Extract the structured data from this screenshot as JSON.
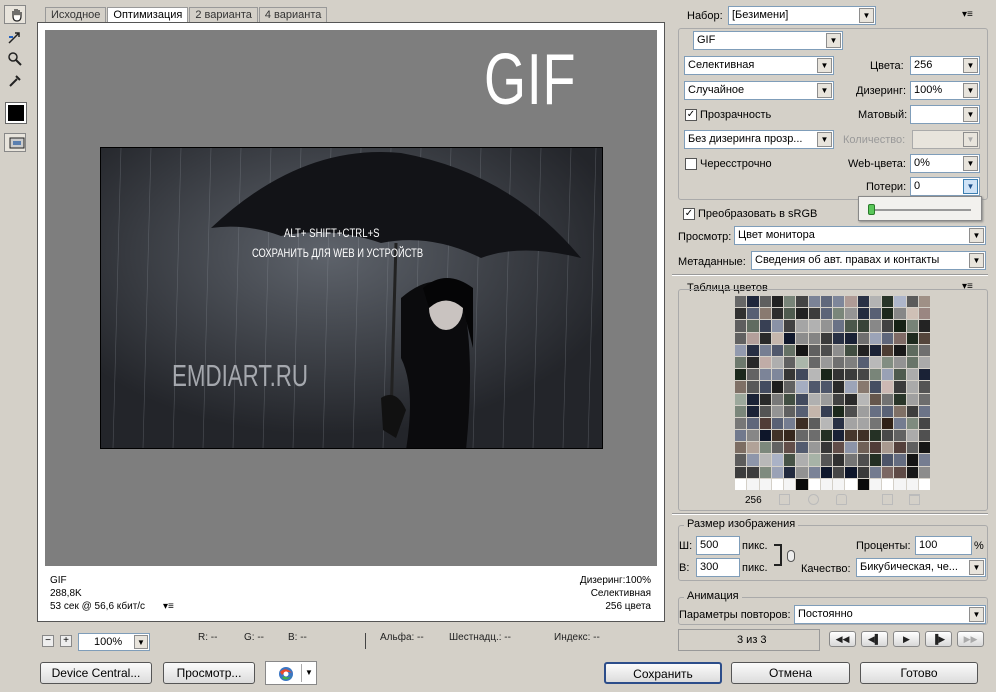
{
  "tabs": [
    "Исходное",
    "Оптимизация",
    "2 варианта",
    "4 варианта"
  ],
  "active_tab": 1,
  "tools": {
    "hand": "hand-icon",
    "slice_select": "slice-select-icon",
    "zoom": "zoom-icon",
    "eyedropper": "eyedropper-icon",
    "color": "#000000",
    "toggle_slices": "toggle-slices-icon"
  },
  "image": {
    "gif_overlay": "GIF",
    "line1": "ALT+ SHIFT+CTRL+S",
    "line2": "СОХРАНИТЬ ДЛЯ WEB И УСТРОЙСТВ",
    "watermark": "EMDIART.RU"
  },
  "info": {
    "format": "GIF",
    "size": "288,8K",
    "time": "53 сек @ 56,6 кбит/с",
    "dither": "Дизеринг:100%",
    "palette": "Селективная",
    "colors": "256 цвета"
  },
  "status": {
    "zoom": "100%",
    "r": "R: --",
    "g": "G: --",
    "b": "B: --",
    "alpha": "Альфа: --",
    "hex": "Шестнадц.: --",
    "index": "Индекс: --"
  },
  "buttons": {
    "device_central": "Device Central...",
    "preview": "Просмотр...",
    "save": "Сохранить",
    "cancel": "Отмена",
    "done": "Готово"
  },
  "settings": {
    "preset_label": "Набор:",
    "preset": "[Безимени]",
    "format": "GIF",
    "reduction": "Селективная",
    "colors_label": "Цвета:",
    "colors": "256",
    "dither_algo": "Случайное",
    "dither_label": "Дизеринг:",
    "dither": "100%",
    "transparency": "Прозрачность",
    "matte_label": "Матовый:",
    "matte": "",
    "trans_dither": "Без дизеринга прозр...",
    "amount_label": "Количество:",
    "interlaced": "Чересстрочно",
    "web_snap_label": "Web-цвета:",
    "web_snap": "0%",
    "lossy_label": "Потери:",
    "lossy": "0",
    "convert_srgb": "Преобразовать в sRGB",
    "preview_label": "Просмотр:",
    "preview": "Цвет монитора",
    "metadata_label": "Метаданные:",
    "metadata": "Сведения об авт. правах и контакты"
  },
  "color_table": {
    "title": "Таблица цветов",
    "count": "256"
  },
  "image_size": {
    "title": "Размер изображения",
    "w_label": "Ш:",
    "w": "500",
    "h_label": "В:",
    "h": "300",
    "unit": "пикс.",
    "percent_label": "Проценты:",
    "percent": "100",
    "percent_unit": "%",
    "quality_label": "Качество:",
    "quality": "Бикубическая, че..."
  },
  "animation": {
    "title": "Анимация",
    "loop_label": "Параметры повторов:",
    "loop": "Постоянно",
    "frame": "3 из 3"
  }
}
